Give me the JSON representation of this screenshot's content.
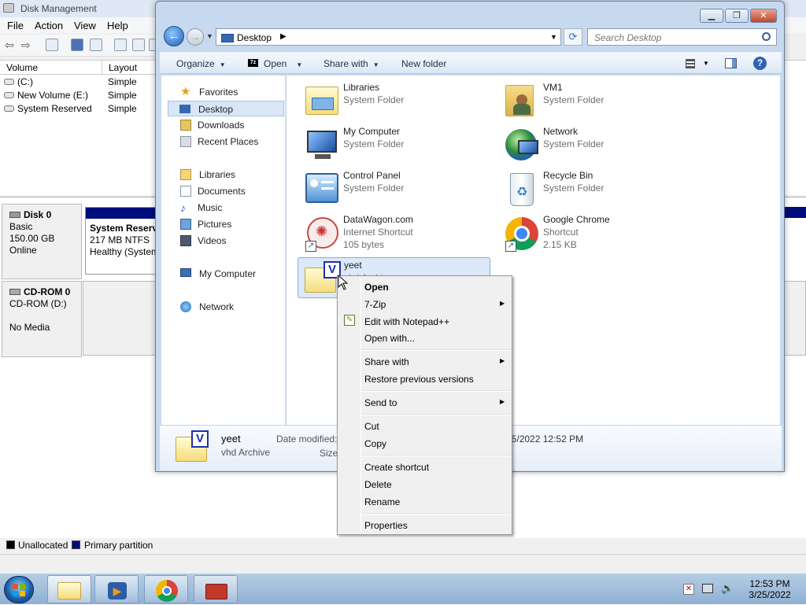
{
  "disk_mgmt": {
    "title": "Disk Management",
    "menu": [
      "File",
      "Action",
      "View",
      "Help"
    ],
    "columns": [
      "Volume",
      "Layout"
    ],
    "volumes": [
      {
        "name": "(C:)",
        "layout": "Simple"
      },
      {
        "name": "New Volume (E:)",
        "layout": "Simple"
      },
      {
        "name": "System Reserved",
        "layout": "Simple"
      }
    ],
    "disk0": {
      "name": "Disk 0",
      "type": "Basic",
      "size": "150.00 GB",
      "status": "Online"
    },
    "partition": {
      "name": "System Reserv",
      "detail": "217 MB NTFS",
      "health": "Healthy (System"
    },
    "cdrom": {
      "name": "CD-ROM 0",
      "drive": "CD-ROM (D:)",
      "media": "No Media"
    },
    "legend": [
      {
        "label": "Unallocated",
        "color": "#000000"
      },
      {
        "label": "Primary partition",
        "color": "#000c7c"
      }
    ]
  },
  "explorer": {
    "address": "Desktop",
    "search_placeholder": "Search Desktop",
    "commands": {
      "organize": "Organize",
      "open": "Open",
      "share": "Share with",
      "newfolder": "New folder"
    },
    "sidebar": {
      "favorites": "Favorites",
      "desktop": "Desktop",
      "downloads": "Downloads",
      "recent": "Recent Places",
      "libraries": "Libraries",
      "documents": "Documents",
      "music": "Music",
      "pictures": "Pictures",
      "videos": "Videos",
      "computer": "My Computer",
      "network": "Network"
    },
    "items": {
      "libraries": {
        "name": "Libraries",
        "type": "System Folder"
      },
      "vm1": {
        "name": "VM1",
        "type": "System Folder"
      },
      "computer": {
        "name": "My Computer",
        "type": "System Folder"
      },
      "network": {
        "name": "Network",
        "type": "System Folder"
      },
      "control": {
        "name": "Control Panel",
        "type": "System Folder"
      },
      "recycle": {
        "name": "Recycle Bin",
        "type": "System Folder"
      },
      "datawagon": {
        "name": "DataWagon.com",
        "type": "Internet Shortcut",
        "size": "105 bytes"
      },
      "chrome": {
        "name": "Google Chrome",
        "type": "Shortcut",
        "size": "2.15 KB"
      },
      "yeet": {
        "name": "yeet",
        "type": "vhd Archive"
      }
    },
    "details": {
      "name": "yeet",
      "type": "vhd Archive",
      "date_label": "Date modified:",
      "date_value": "3/25/2022 12:52 PM",
      "size_label": "Size:"
    }
  },
  "context_menu": {
    "open": "Open",
    "zip": "7-Zip",
    "notepad": "Edit with Notepad++",
    "openwith": "Open with...",
    "sharewith": "Share with",
    "restore": "Restore previous versions",
    "sendto": "Send to",
    "cut": "Cut",
    "copy": "Copy",
    "shortcut": "Create shortcut",
    "delete": "Delete",
    "rename": "Rename",
    "properties": "Properties"
  },
  "taskbar": {
    "time": "12:53 PM",
    "date": "3/25/2022"
  },
  "icons": [
    "folder-icon",
    "computer-icon",
    "network-icon",
    "control-panel-icon",
    "recycle-bin-icon",
    "chrome-icon",
    "star-icon",
    "vhd-icon",
    "notepadpp-icon",
    "windows-start-icon"
  ]
}
